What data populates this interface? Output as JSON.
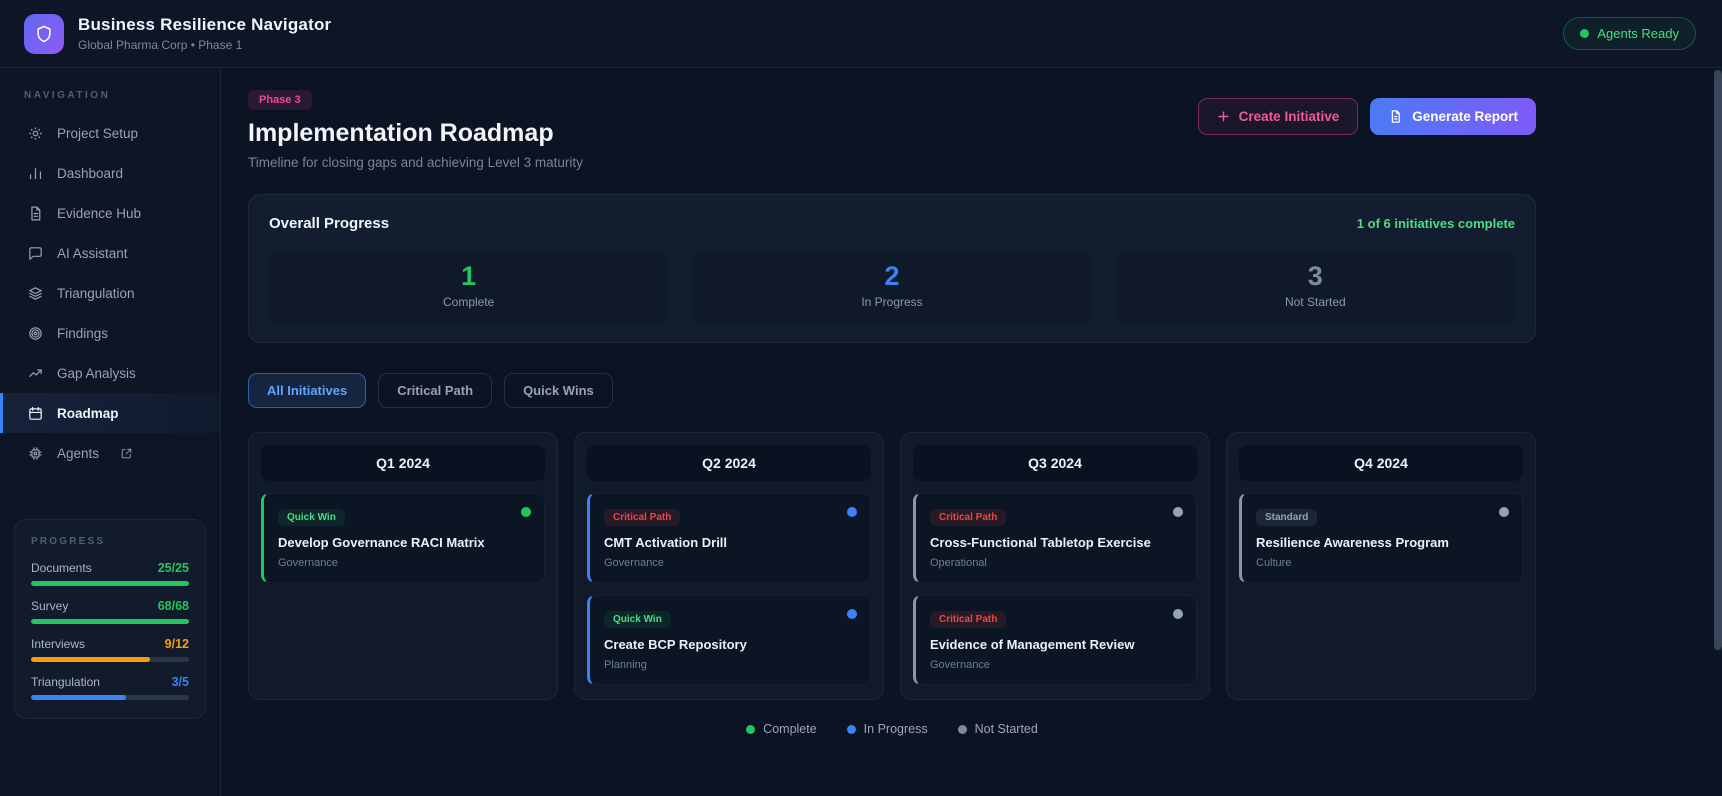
{
  "header": {
    "title": "Business Resilience Navigator",
    "subtitle": "Global Pharma Corp • Phase 1",
    "status_badge": "Agents Ready"
  },
  "sidebar": {
    "nav_label": "NAVIGATION",
    "items": [
      {
        "label": "Project Setup",
        "icon": "sun",
        "active": false,
        "external": false
      },
      {
        "label": "Dashboard",
        "icon": "bar-chart",
        "active": false,
        "external": false
      },
      {
        "label": "Evidence Hub",
        "icon": "document",
        "active": false,
        "external": false
      },
      {
        "label": "AI Assistant",
        "icon": "chat",
        "active": false,
        "external": false
      },
      {
        "label": "Triangulation",
        "icon": "layers",
        "active": false,
        "external": false
      },
      {
        "label": "Findings",
        "icon": "target",
        "active": false,
        "external": false
      },
      {
        "label": "Gap Analysis",
        "icon": "trend",
        "active": false,
        "external": false
      },
      {
        "label": "Roadmap",
        "icon": "calendar",
        "active": true,
        "external": false
      },
      {
        "label": "Agents",
        "icon": "chip",
        "active": false,
        "external": true
      }
    ],
    "progress": {
      "label": "PROGRESS",
      "rows": [
        {
          "label": "Documents",
          "value": "25/25",
          "pct": 100,
          "color": "#22c55e"
        },
        {
          "label": "Survey",
          "value": "68/68",
          "pct": 100,
          "color": "#22c55e"
        },
        {
          "label": "Interviews",
          "value": "9/12",
          "pct": 75,
          "color": "#f59e0b"
        },
        {
          "label": "Triangulation",
          "value": "3/5",
          "pct": 60,
          "color": "#3b82f6"
        }
      ]
    }
  },
  "main": {
    "phase_badge": "Phase 3",
    "title": "Implementation Roadmap",
    "subtitle": "Timeline for closing gaps and achieving Level 3 maturity",
    "buttons": {
      "create": "Create Initiative",
      "report": "Generate Report"
    },
    "overall": {
      "title": "Overall Progress",
      "summary": "1 of 6 initiatives complete",
      "stats": [
        {
          "value": "1",
          "label": "Complete",
          "color": "#22c55e"
        },
        {
          "value": "2",
          "label": "In Progress",
          "color": "#3b82f6"
        },
        {
          "value": "3",
          "label": "Not Started",
          "color": "#7d8ba0"
        }
      ]
    },
    "tabs": [
      {
        "label": "All Initiatives",
        "active": true
      },
      {
        "label": "Critical Path",
        "active": false
      },
      {
        "label": "Quick Wins",
        "active": false
      }
    ],
    "quarters": [
      {
        "label": "Q1 2024",
        "cards": [
          {
            "badge": "Quick Win",
            "badge_type": "green",
            "title": "Develop Governance RACI Matrix",
            "category": "Governance",
            "status": "complete"
          }
        ]
      },
      {
        "label": "Q2 2024",
        "cards": [
          {
            "badge": "Critical Path",
            "badge_type": "red",
            "title": "CMT Activation Drill",
            "category": "Governance",
            "status": "in_progress"
          },
          {
            "badge": "Quick Win",
            "badge_type": "green",
            "title": "Create BCP Repository",
            "category": "Planning",
            "status": "in_progress"
          }
        ]
      },
      {
        "label": "Q3 2024",
        "cards": [
          {
            "badge": "Critical Path",
            "badge_type": "red",
            "title": "Cross-Functional Tabletop Exercise",
            "category": "Operational",
            "status": "not_started"
          },
          {
            "badge": "Critical Path",
            "badge_type": "red",
            "title": "Evidence of Management Review",
            "category": "Governance",
            "status": "not_started"
          }
        ]
      },
      {
        "label": "Q4 2024",
        "cards": [
          {
            "badge": "Standard",
            "badge_type": "gray",
            "title": "Resilience Awareness Program",
            "category": "Culture",
            "status": "not_started"
          }
        ]
      }
    ],
    "legend": [
      {
        "label": "Complete",
        "color": "#22c55e"
      },
      {
        "label": "In Progress",
        "color": "#3b82f6"
      },
      {
        "label": "Not Started",
        "color": "#7d8ba0"
      }
    ],
    "status_colors": {
      "complete": "#22c55e",
      "in_progress": "#3b82f6",
      "not_started": "#97a3b4"
    }
  }
}
